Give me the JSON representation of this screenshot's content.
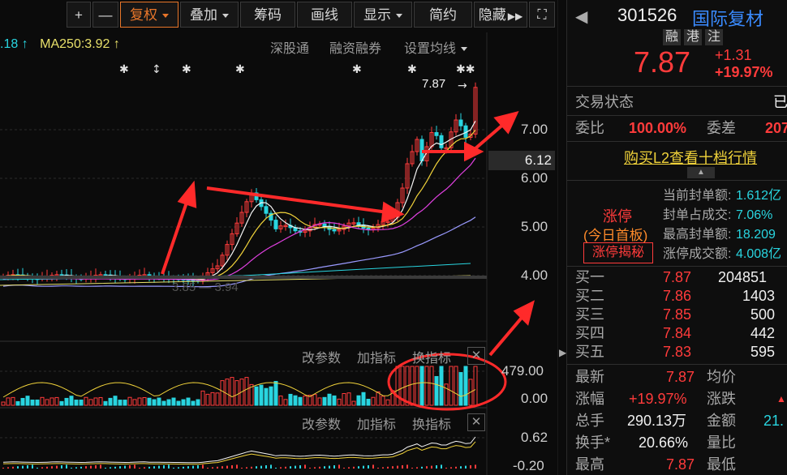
{
  "toolbar": {
    "plus": "+",
    "minus": "—",
    "fuquan": "复权",
    "diejia": "叠加",
    "chouma": "筹码",
    "huaxian": "画线",
    "xianshi": "显示",
    "jianyue": "简约",
    "yincang": "隐藏"
  },
  "chart": {
    "ma_left": ".18",
    "ma250": "MA250:3.92",
    "links": [
      "深股通",
      "融资融券",
      "设置均线"
    ],
    "price_marker": "7.87",
    "y_labels": [
      "7.00",
      "6.00",
      "5.00",
      "4.00"
    ],
    "current_price_box": "6.12",
    "low_label": "3.85",
    "low_label2": "3.94",
    "vol_controls": [
      "改参数",
      "加指标",
      "换指标"
    ],
    "vol_labels": [
      "479.00",
      "0.00"
    ],
    "ind_controls": [
      "改参数",
      "加指标",
      "换指标"
    ],
    "ind_labels": [
      "0.62",
      "-0.20"
    ]
  },
  "chart_data": {
    "type": "candlestick",
    "title": "",
    "y_ticks": [
      7.0,
      6.0,
      5.0,
      4.0
    ],
    "last_price": 7.87,
    "ma250": 3.92,
    "volume_axis": [
      0.0,
      479.0
    ],
    "indicator_axis": [
      -0.2,
      0.62
    ]
  },
  "panel": {
    "code": "301526",
    "name": "国际复材",
    "tags": [
      "融",
      "港",
      "注"
    ],
    "price": "7.87",
    "change": "+1.31",
    "change_pct": "+19.97%",
    "trade_status_label": "交易状态",
    "trade_status_value": "已",
    "weibi_label": "委比",
    "weibi_value": "100.00%",
    "weicha_label": "委差",
    "weicha_value": "207",
    "l2_link": "购买L2查看十档行情",
    "zt_title": "涨停",
    "zt_sub": "(今日首板)",
    "zt_button": "涨停揭秘",
    "zt_rows": [
      {
        "label": "当前封单额:",
        "value": "1.612亿"
      },
      {
        "label": "封单占成交:",
        "value": "7.06%"
      },
      {
        "label": "最高封单额:",
        "value": "18.209"
      },
      {
        "label": "涨停成交额:",
        "value": "4.008亿"
      }
    ],
    "bids": [
      {
        "label": "买一",
        "price": "7.87",
        "vol": "204851"
      },
      {
        "label": "买二",
        "price": "7.86",
        "vol": "1403"
      },
      {
        "label": "买三",
        "price": "7.85",
        "vol": "500"
      },
      {
        "label": "买四",
        "price": "7.84",
        "vol": "442"
      },
      {
        "label": "买五",
        "price": "7.83",
        "vol": "595"
      }
    ],
    "stats": [
      {
        "l1": "最新",
        "v1": "7.87",
        "l2": "均价",
        "v2": ""
      },
      {
        "l1": "涨幅",
        "v1": "+19.97%",
        "l2": "涨跌",
        "v2": "▲"
      },
      {
        "l1": "总手",
        "v1": "290.13万",
        "l2": "金额",
        "v2": "21."
      },
      {
        "l1": "换手*",
        "v1": "20.66%",
        "l2": "量比",
        "v2": ""
      },
      {
        "l1": "最高",
        "v1": "7.87",
        "l2": "最低",
        "v2": ""
      }
    ]
  }
}
